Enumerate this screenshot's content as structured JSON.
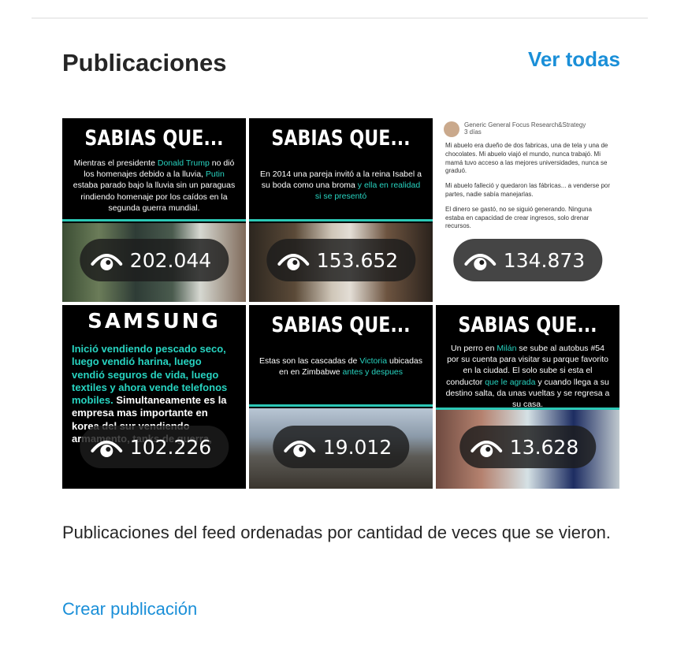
{
  "section": {
    "title": "Publicaciones",
    "see_all_label": "Ver todas"
  },
  "posts": [
    {
      "headline": "SABIAS QUE...",
      "caption_parts": [
        "Mientras el presidente ",
        "Donald Trump",
        " no dió los homenajes debido a la lluvia, ",
        "Putin",
        " estaba parado bajo la lluvia sin un paraguas rindiendo homenaje por los caídos en la segunda guerra mundial."
      ],
      "views": "202.044"
    },
    {
      "headline": "SABIAS QUE...",
      "caption_parts": [
        "En 2014 una pareja invitó a la reina Isabel a su boda como una broma",
        " y ella en realidad si se presentó"
      ],
      "views": "153.652"
    },
    {
      "author": "Generic General Focus Research&Strategy",
      "time": "3 días",
      "paragraphs": [
        "Mi abuelo era dueño de dos fabricas, una de tela y una de chocolates. Mi abuelo viajó el mundo, nunca trabajó. Mi mamá tuvo acceso a las mejores universidades, nunca se graduó.",
        "Mi abuelo falleció y quedaron las fábricas... a venderse por partes, nadie sabía manejarlas.",
        "El dinero se gastó, no se siguió generando. Ninguna estaba en capacidad de crear ingresos, solo drenar recursos."
      ],
      "views": "134.873"
    },
    {
      "brand": "SAMSUNG",
      "body_accent": "Inició vendiendo pescado seco, luego vendió harina, luego vendió seguros de vida, luego textiles y ahora vende telefonos mobiles.",
      "body_rest": " Simultaneamente es la empresa mas importante en korea del sur vendiendo armamento, tanks de guerra,",
      "views": "102.226"
    },
    {
      "headline": "SABIAS QUE...",
      "caption_parts": [
        "Estas son las cascadas de ",
        "Victoria",
        " ubicadas en en Zimbabwe ",
        "antes y despues"
      ],
      "views": "19.012"
    },
    {
      "headline": "SABIAS QUE...",
      "caption_parts": [
        "Un perro en ",
        "Milán",
        " se sube al autobus #54 por su cuenta para visitar su parque favorito en la ciudad. El solo sube si esta el conductor ",
        "que le agrada",
        " y cuando llega a su destino salta, da unas vueltas y se regresa a su casa."
      ],
      "views": "13.628"
    }
  ],
  "footer": {
    "description": "Publicaciones del feed ordenadas por cantidad de veces que se vieron.",
    "create_label": "Crear publicación"
  },
  "colors": {
    "accent_link": "#1a8fd8",
    "teal": "#27d3c0"
  },
  "icons": {
    "views": "eye-icon"
  }
}
